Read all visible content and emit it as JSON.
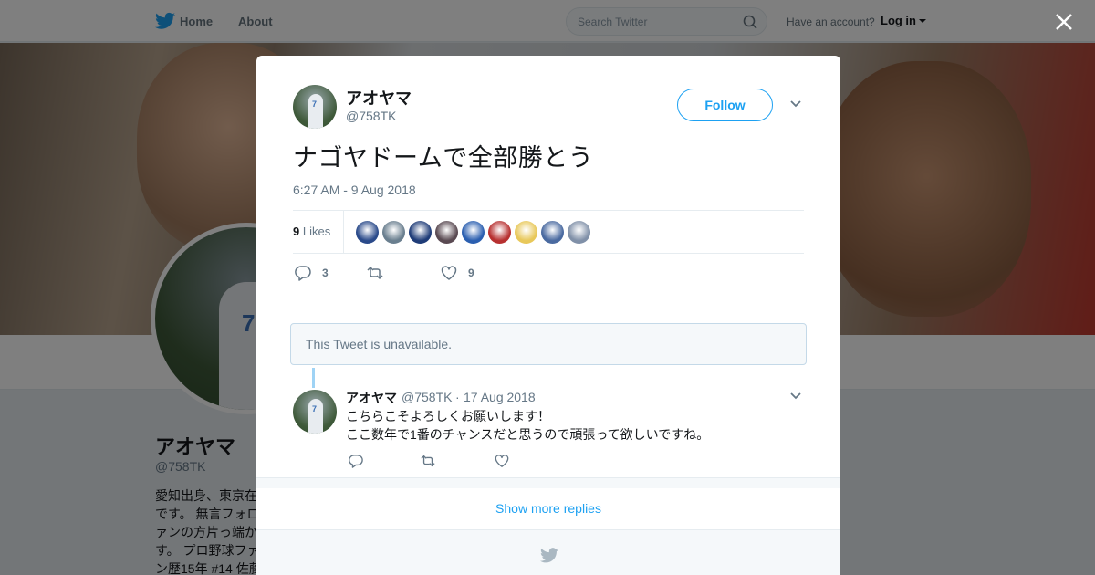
{
  "topbar": {
    "home_label": "Home",
    "about_label": "About",
    "search_placeholder": "Search Twitter",
    "have_account": "Have an account?",
    "login_label": "Log in"
  },
  "profile": {
    "name": "アオヤマ",
    "handle": "@758TK",
    "bio_lines": [
      "愛知出身、東京在",
      "です。 無言フォロ",
      "ァンの方片っ端か",
      "す。 プロ野球ファ",
      "ン歴15年 #14 佐藤"
    ]
  },
  "tweet": {
    "name": "アオヤマ",
    "handle": "@758TK",
    "follow_label": "Follow",
    "text": "ナゴヤドームで全部勝とう",
    "timestamp": "6:27 AM - 9 Aug 2018",
    "likes_count": "9",
    "likes_label": "Likes",
    "reply_count": "3",
    "retweet_count": "",
    "like_count": "9",
    "liker_colors": [
      "#2a4a8a",
      "#6a7f8f",
      "#1f3c78",
      "#5a4a52",
      "#2b5fb0",
      "#b73030",
      "#e8c85a",
      "#4a6aa0",
      "#8090a8"
    ]
  },
  "unavailable_text": "This Tweet is unavailable.",
  "reply": {
    "name": "アオヤマ",
    "handle": "@758TK",
    "separator": "·",
    "date": "17 Aug 2018",
    "line1": "こちらこそよろしくお願いします！",
    "line2": "ここ数年で1番のチャンスだと思うので頑張って欲しいですね。"
  },
  "show_more_label": "Show more replies",
  "colors": {
    "accent": "#1da1f2",
    "text": "#14171a",
    "muted": "#657786"
  },
  "icons": [
    "twitter-bird-icon",
    "search-icon",
    "close-icon",
    "chevron-down-icon",
    "reply-icon",
    "retweet-icon",
    "heart-icon"
  ]
}
